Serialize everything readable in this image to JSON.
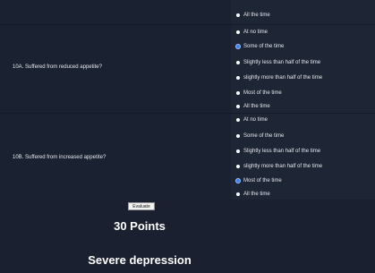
{
  "questions": [
    {
      "label": "",
      "options": [
        {
          "label": "All the time",
          "selected": false
        }
      ]
    },
    {
      "label": "10A. Suffered from reduced appetite?",
      "options": [
        {
          "label": "At no time",
          "selected": false
        },
        {
          "label": "Some of the time",
          "selected": true
        },
        {
          "label": "Slightly less than half of the time",
          "selected": false
        },
        {
          "label": "slightly more than half of the time",
          "selected": false
        },
        {
          "label": "Most of the time",
          "selected": false
        },
        {
          "label": "All the time",
          "selected": false
        }
      ]
    },
    {
      "label": "10B. Suffered from increased appetite?",
      "options": [
        {
          "label": "At no time",
          "selected": false
        },
        {
          "label": "Some of the time",
          "selected": false
        },
        {
          "label": "Slightly less than half of the time",
          "selected": false
        },
        {
          "label": "slightly more than half of the time",
          "selected": false
        },
        {
          "label": "Most of the time",
          "selected": true
        },
        {
          "label": "All the time",
          "selected": false
        }
      ]
    }
  ],
  "evaluate_label": "Evaluate",
  "result": {
    "points": "30 Points",
    "diagnosis": "Severe depression"
  },
  "colors": {
    "background": "#1b2030",
    "selected_radio": "#3b82f6",
    "text": "#ffffff"
  }
}
